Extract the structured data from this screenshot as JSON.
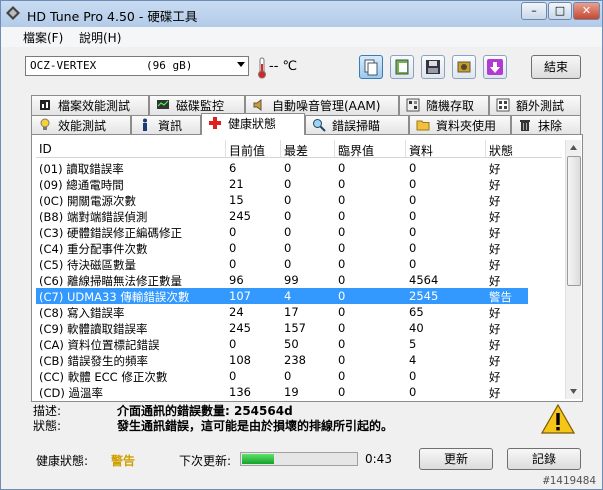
{
  "app": {
    "title": "HD Tune Pro 4.50 - 硬碟工具"
  },
  "window_buttons": {
    "min": "–",
    "max": "□",
    "close": "✕"
  },
  "menu": [
    {
      "label": "檔案(F)"
    },
    {
      "label": "說明(H)"
    }
  ],
  "toolbar": {
    "drive_name": "OCZ-VERTEX",
    "drive_size": "(96 gB)",
    "temperature": "-- ℃",
    "exit_label": "結束"
  },
  "tabs_row1": [
    {
      "label": "檔案效能測試",
      "icon": "bar-icon"
    },
    {
      "label": "磁碟監控",
      "icon": "monitor-icon"
    },
    {
      "label": "自動噪音管理(AAM)",
      "icon": "speaker-icon"
    },
    {
      "label": "隨機存取",
      "icon": "random-icon"
    },
    {
      "label": "額外測試",
      "icon": "extra-icon"
    }
  ],
  "tabs_row2": [
    {
      "label": "效能測試",
      "icon": "bulb-icon"
    },
    {
      "label": "資訊",
      "icon": "info-icon"
    },
    {
      "label": "健康狀態",
      "icon": "health-icon"
    },
    {
      "label": "錯誤掃瞄",
      "icon": "magnifier-icon"
    },
    {
      "label": "資料夾使用",
      "icon": "folder-icon"
    },
    {
      "label": "抹除",
      "icon": "trash-icon"
    }
  ],
  "table": {
    "headers": [
      "ID",
      "目前值",
      "最差",
      "臨界值",
      "資料",
      "狀態"
    ],
    "rows": [
      [
        "(01) 讀取錯誤率",
        "6",
        "0",
        "0",
        "0",
        "好"
      ],
      [
        "(09) 總通電時間",
        "21",
        "0",
        "0",
        "0",
        "好"
      ],
      [
        "(0C) 開關電源次數",
        "15",
        "0",
        "0",
        "0",
        "好"
      ],
      [
        "(B8) 端對端錯誤偵測",
        "245",
        "0",
        "0",
        "0",
        "好"
      ],
      [
        "(C3) 硬體錯誤修正編碼修正",
        "0",
        "0",
        "0",
        "0",
        "好"
      ],
      [
        "(C4) 重分配事件次數",
        "0",
        "0",
        "0",
        "0",
        "好"
      ],
      [
        "(C5) 待決磁區數量",
        "0",
        "0",
        "0",
        "0",
        "好"
      ],
      [
        "(C6) 離線掃瞄無法修正數量",
        "96",
        "99",
        "0",
        "4564",
        "好"
      ],
      [
        "(C7) UDMA33 傳輸錯誤次數",
        "107",
        "4",
        "0",
        "2545",
        "警告"
      ],
      [
        "(C8) 寫入錯誤率",
        "24",
        "17",
        "0",
        "65",
        "好"
      ],
      [
        "(C9) 軟體讀取錯誤率",
        "245",
        "157",
        "0",
        "40",
        "好"
      ],
      [
        "(CA) 資料位置標記錯誤",
        "0",
        "50",
        "0",
        "5",
        "好"
      ],
      [
        "(CB) 錯誤發生的頻率",
        "108",
        "238",
        "0",
        "4",
        "好"
      ],
      [
        "(CC) 軟體 ECC 修正次數",
        "0",
        "0",
        "0",
        "0",
        "好"
      ],
      [
        "(CD) 過溫率",
        "136",
        "19",
        "0",
        "0",
        "好"
      ]
    ],
    "selected_row": 8
  },
  "description": {
    "desc_label": "描述:",
    "desc_value": "介面通訊的錯誤數量: 254564d",
    "status_label": "狀態:",
    "status_value": "發生通訊錯誤，這可能是由於損壞的排線所引起的。"
  },
  "status_bar": {
    "health_label": "健康狀態:",
    "health_value": "警告",
    "next_update_label": "下次更新:",
    "progress_fraction": 0.28,
    "timer": "0:43",
    "refresh_label": "更新",
    "log_label": "記錄",
    "health_color": "#d0a000"
  },
  "watermark": "#1419484",
  "colors": {
    "selection": "#3399ff",
    "warning": "#d0a000"
  }
}
